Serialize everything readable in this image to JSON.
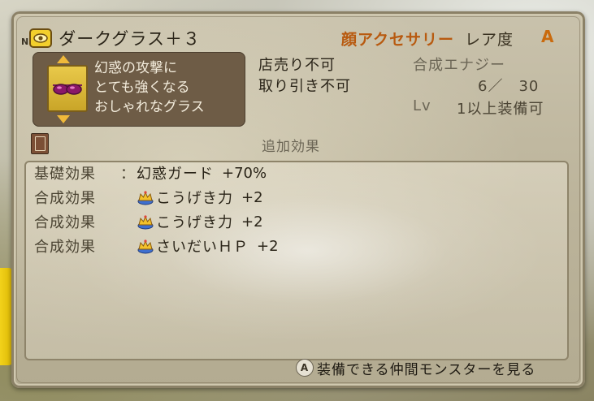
{
  "item": {
    "rank_mark": "N",
    "name": "ダークグラス＋３",
    "category": "顔アクセサリー",
    "rarity_label": "レア度",
    "rarity_value": "A",
    "type_icon": "accessory-eye-icon",
    "image_icon": "dark-glasses-icon",
    "description": [
      "幻惑の攻撃に",
      "とても強くなる",
      "おしゃれなグラス"
    ]
  },
  "info": {
    "sell": "店売り不可",
    "trade": "取り引き不可",
    "synth_energy_label": "合成エナジー",
    "synth_energy_value": "6／　30",
    "level_label": "Lv",
    "level_req": "1以上装備可"
  },
  "effects": {
    "title": "追加効果",
    "rows": [
      {
        "label": "基礎効果",
        "sep": "：",
        "icon": "",
        "name": "幻惑ガード",
        "value": "+70%"
      },
      {
        "label": "合成効果",
        "sep": "",
        "icon": "crown-icon",
        "name": "こうげき力",
        "value": "+2"
      },
      {
        "label": "合成効果",
        "sep": "",
        "icon": "crown-icon",
        "name": "こうげき力",
        "value": "+2"
      },
      {
        "label": "合成効果",
        "sep": "",
        "icon": "crown-icon",
        "name": "さいだいＨＰ",
        "value": "+2"
      }
    ]
  },
  "footer": {
    "button_glyph": "A",
    "action": "装備できる仲間モンスターを見る"
  }
}
